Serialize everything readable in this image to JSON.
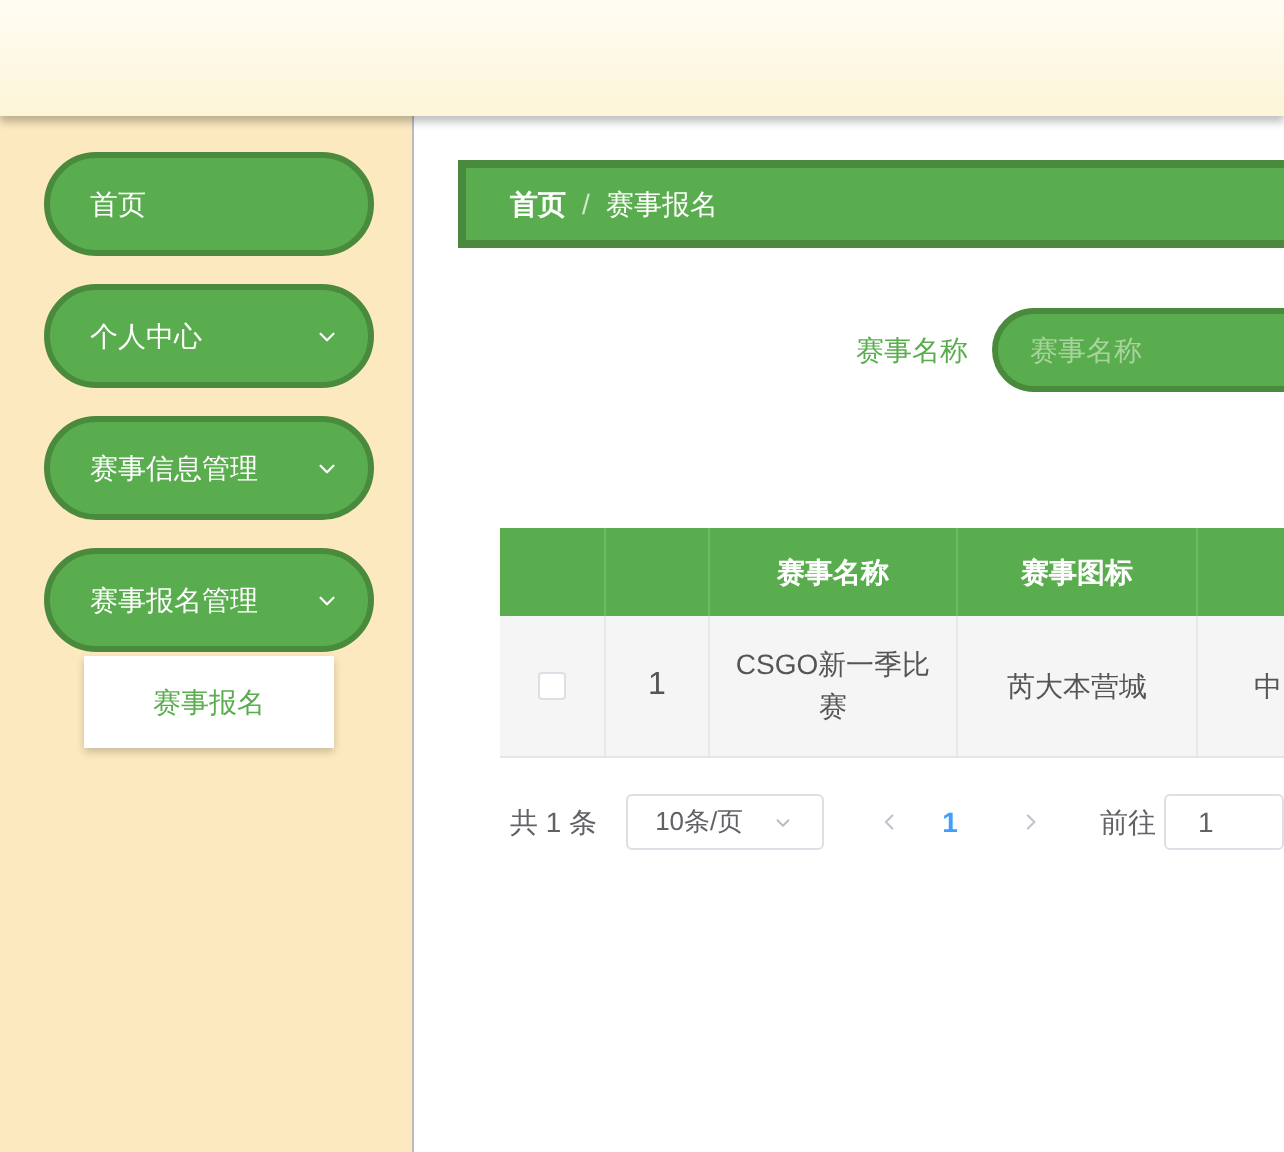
{
  "sidebar": {
    "items": [
      {
        "label": "首页",
        "expandable": false
      },
      {
        "label": "个人中心",
        "expandable": true
      },
      {
        "label": "赛事信息管理",
        "expandable": true
      },
      {
        "label": "赛事报名管理",
        "expandable": true,
        "children": [
          {
            "label": "赛事报名"
          }
        ]
      }
    ]
  },
  "breadcrumb": [
    "首页",
    "/",
    "赛事报名"
  ],
  "search": {
    "label": "赛事名称",
    "placeholder": "赛事名称"
  },
  "table": {
    "columns": [
      "",
      "赛事名称",
      "赛事图标"
    ],
    "rows": [
      {
        "checked": false,
        "cells": [
          "1",
          "CSGO新一季比赛",
          "芮大本营城",
          "中"
        ]
      }
    ]
  },
  "pagination": {
    "total": "共 1 条",
    "page_size": "10条/页",
    "pages": [
      {
        "label": "1",
        "selected": true
      }
    ],
    "goto_label": "前往",
    "goto_value": "1"
  }
}
